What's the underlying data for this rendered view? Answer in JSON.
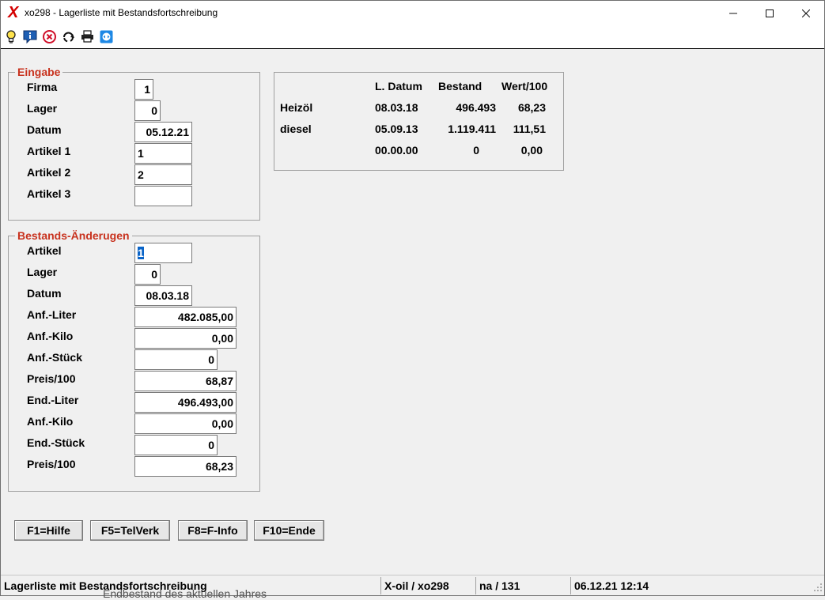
{
  "window": {
    "title": "xo298 - Lagerliste mit Bestandsfortschreibung",
    "app_icon": "X"
  },
  "icons": {
    "app": "x-logo-icon",
    "toolbar": [
      "lightbulb-icon",
      "info-icon",
      "cancel-icon",
      "refresh-icon",
      "printer-icon",
      "remote-icon"
    ]
  },
  "eingabe": {
    "title": "Eingabe",
    "fields": [
      {
        "label": "Firma",
        "value": "1"
      },
      {
        "label": "Lager",
        "value": "0"
      },
      {
        "label": "Datum",
        "value": "05.12.21"
      },
      {
        "label": "Artikel 1",
        "value": "1"
      },
      {
        "label": "Artikel 2",
        "value": "2"
      },
      {
        "label": "Artikel 3",
        "value": ""
      }
    ]
  },
  "bestand": {
    "title": "Bestands-Änderugen",
    "fields": [
      {
        "label": "Artikel",
        "value": "1"
      },
      {
        "label": "Lager",
        "value": "0"
      },
      {
        "label": "Datum",
        "value": "08.03.18"
      },
      {
        "label": "Anf.-Liter",
        "value": "482.085,00"
      },
      {
        "label": "Anf.-Kilo",
        "value": "0,00"
      },
      {
        "label": "Anf.-Stück",
        "value": "0"
      },
      {
        "label": "Preis/100",
        "value": "68,87"
      },
      {
        "label": "End.-Liter",
        "value": "496.493,00"
      },
      {
        "label": "Anf.-Kilo",
        "value": "0,00"
      },
      {
        "label": "End.-Stück",
        "value": "0"
      },
      {
        "label": "Preis/100",
        "value": "68,23"
      }
    ]
  },
  "info_table": {
    "headers": [
      "L. Datum",
      "Bestand",
      "Wert/100"
    ],
    "rows": [
      {
        "name": "Heizöl",
        "datum": "08.03.18",
        "bestand": "496.493",
        "wert": "68,23"
      },
      {
        "name": "diesel",
        "datum": "05.09.13",
        "bestand": "1.119.411",
        "wert": "111,51"
      },
      {
        "name": "",
        "datum": "00.00.00",
        "bestand": "0",
        "wert": "0,00"
      }
    ]
  },
  "buttons": [
    "F1=Hilfe",
    "F5=TelVerk",
    "F8=F-Info",
    "F10=Ende"
  ],
  "status": [
    "Lagerliste mit Bestandsfortschreibung",
    "X-oil / xo298",
    "na / 131",
    "06.12.21 12:14"
  ],
  "ghost_text": "Endbestand des aktuellen Jahres"
}
